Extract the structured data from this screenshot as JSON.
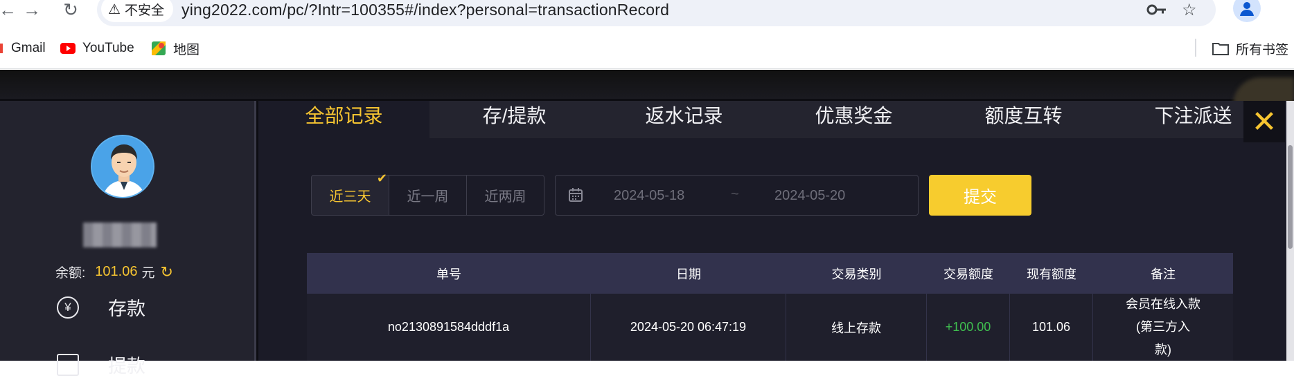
{
  "browser": {
    "insecure_label": "不安全",
    "url": "ying2022.com/pc/?Intr=100355#/index?personal=transactionRecord",
    "bookmarks": [
      {
        "label": "Gmail",
        "icon": "gmail-icon"
      },
      {
        "label": "YouTube",
        "icon": "youtube-icon"
      },
      {
        "label": "地图",
        "icon": "maps-icon"
      }
    ],
    "all_bookmarks_label": "所有书签"
  },
  "sidebar": {
    "balance_label": "余额:",
    "balance_value": "101.06",
    "balance_unit": "元",
    "items": [
      {
        "label": "存款",
        "icon": "yen-circle-icon"
      },
      {
        "label": "提款",
        "icon": "card-icon"
      }
    ]
  },
  "tabs": [
    {
      "label": "全部记录",
      "active": true
    },
    {
      "label": "存/提款",
      "active": false
    },
    {
      "label": "返水记录",
      "active": false
    },
    {
      "label": "优惠奖金",
      "active": false
    },
    {
      "label": "额度互转",
      "active": false
    },
    {
      "label": "下注派送",
      "active": false
    }
  ],
  "filters": {
    "ranges": [
      "近三天",
      "近一周",
      "近两周"
    ],
    "selected_range": "近三天",
    "date_from": "2024-05-18",
    "date_separator": "~",
    "date_to": "2024-05-20",
    "submit_label": "提交"
  },
  "table": {
    "columns": [
      "单号",
      "日期",
      "交易类别",
      "交易额度",
      "现有额度",
      "备注"
    ],
    "rows": [
      {
        "order_no": "no2130891584dddf1a",
        "date": "2024-05-20 06:47:19",
        "type": "线上存款",
        "amount": "+100.00",
        "balance": "101.06",
        "note": [
          "会员在线入款",
          "(第三方入",
          "款)"
        ]
      }
    ]
  },
  "colors": {
    "accent": "#f7c531",
    "positive": "#3fbf4f",
    "header_bg": "#32324d",
    "panel_bg": "#1b1b27"
  }
}
